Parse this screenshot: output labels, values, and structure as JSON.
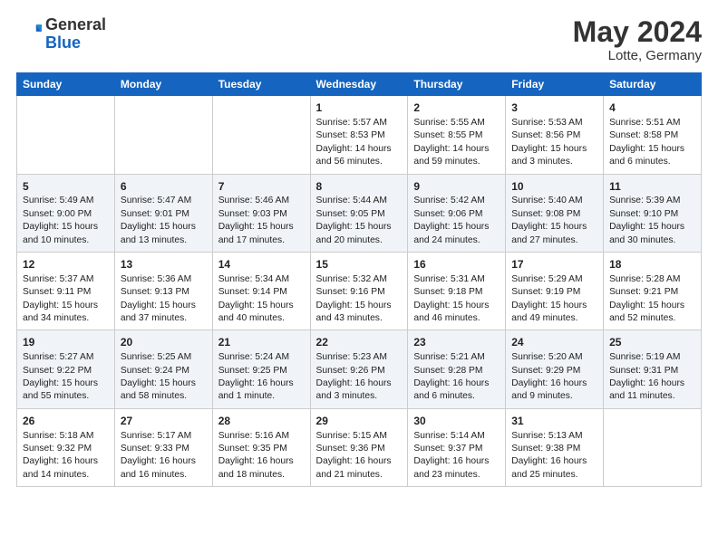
{
  "header": {
    "logo_general": "General",
    "logo_blue": "Blue",
    "month_title": "May 2024",
    "location": "Lotte, Germany"
  },
  "weekdays": [
    "Sunday",
    "Monday",
    "Tuesday",
    "Wednesday",
    "Thursday",
    "Friday",
    "Saturday"
  ],
  "weeks": [
    [
      {
        "day": "",
        "info": ""
      },
      {
        "day": "",
        "info": ""
      },
      {
        "day": "",
        "info": ""
      },
      {
        "day": "1",
        "info": "Sunrise: 5:57 AM\nSunset: 8:53 PM\nDaylight: 14 hours\nand 56 minutes."
      },
      {
        "day": "2",
        "info": "Sunrise: 5:55 AM\nSunset: 8:55 PM\nDaylight: 14 hours\nand 59 minutes."
      },
      {
        "day": "3",
        "info": "Sunrise: 5:53 AM\nSunset: 8:56 PM\nDaylight: 15 hours\nand 3 minutes."
      },
      {
        "day": "4",
        "info": "Sunrise: 5:51 AM\nSunset: 8:58 PM\nDaylight: 15 hours\nand 6 minutes."
      }
    ],
    [
      {
        "day": "5",
        "info": "Sunrise: 5:49 AM\nSunset: 9:00 PM\nDaylight: 15 hours\nand 10 minutes."
      },
      {
        "day": "6",
        "info": "Sunrise: 5:47 AM\nSunset: 9:01 PM\nDaylight: 15 hours\nand 13 minutes."
      },
      {
        "day": "7",
        "info": "Sunrise: 5:46 AM\nSunset: 9:03 PM\nDaylight: 15 hours\nand 17 minutes."
      },
      {
        "day": "8",
        "info": "Sunrise: 5:44 AM\nSunset: 9:05 PM\nDaylight: 15 hours\nand 20 minutes."
      },
      {
        "day": "9",
        "info": "Sunrise: 5:42 AM\nSunset: 9:06 PM\nDaylight: 15 hours\nand 24 minutes."
      },
      {
        "day": "10",
        "info": "Sunrise: 5:40 AM\nSunset: 9:08 PM\nDaylight: 15 hours\nand 27 minutes."
      },
      {
        "day": "11",
        "info": "Sunrise: 5:39 AM\nSunset: 9:10 PM\nDaylight: 15 hours\nand 30 minutes."
      }
    ],
    [
      {
        "day": "12",
        "info": "Sunrise: 5:37 AM\nSunset: 9:11 PM\nDaylight: 15 hours\nand 34 minutes."
      },
      {
        "day": "13",
        "info": "Sunrise: 5:36 AM\nSunset: 9:13 PM\nDaylight: 15 hours\nand 37 minutes."
      },
      {
        "day": "14",
        "info": "Sunrise: 5:34 AM\nSunset: 9:14 PM\nDaylight: 15 hours\nand 40 minutes."
      },
      {
        "day": "15",
        "info": "Sunrise: 5:32 AM\nSunset: 9:16 PM\nDaylight: 15 hours\nand 43 minutes."
      },
      {
        "day": "16",
        "info": "Sunrise: 5:31 AM\nSunset: 9:18 PM\nDaylight: 15 hours\nand 46 minutes."
      },
      {
        "day": "17",
        "info": "Sunrise: 5:29 AM\nSunset: 9:19 PM\nDaylight: 15 hours\nand 49 minutes."
      },
      {
        "day": "18",
        "info": "Sunrise: 5:28 AM\nSunset: 9:21 PM\nDaylight: 15 hours\nand 52 minutes."
      }
    ],
    [
      {
        "day": "19",
        "info": "Sunrise: 5:27 AM\nSunset: 9:22 PM\nDaylight: 15 hours\nand 55 minutes."
      },
      {
        "day": "20",
        "info": "Sunrise: 5:25 AM\nSunset: 9:24 PM\nDaylight: 15 hours\nand 58 minutes."
      },
      {
        "day": "21",
        "info": "Sunrise: 5:24 AM\nSunset: 9:25 PM\nDaylight: 16 hours\nand 1 minute."
      },
      {
        "day": "22",
        "info": "Sunrise: 5:23 AM\nSunset: 9:26 PM\nDaylight: 16 hours\nand 3 minutes."
      },
      {
        "day": "23",
        "info": "Sunrise: 5:21 AM\nSunset: 9:28 PM\nDaylight: 16 hours\nand 6 minutes."
      },
      {
        "day": "24",
        "info": "Sunrise: 5:20 AM\nSunset: 9:29 PM\nDaylight: 16 hours\nand 9 minutes."
      },
      {
        "day": "25",
        "info": "Sunrise: 5:19 AM\nSunset: 9:31 PM\nDaylight: 16 hours\nand 11 minutes."
      }
    ],
    [
      {
        "day": "26",
        "info": "Sunrise: 5:18 AM\nSunset: 9:32 PM\nDaylight: 16 hours\nand 14 minutes."
      },
      {
        "day": "27",
        "info": "Sunrise: 5:17 AM\nSunset: 9:33 PM\nDaylight: 16 hours\nand 16 minutes."
      },
      {
        "day": "28",
        "info": "Sunrise: 5:16 AM\nSunset: 9:35 PM\nDaylight: 16 hours\nand 18 minutes."
      },
      {
        "day": "29",
        "info": "Sunrise: 5:15 AM\nSunset: 9:36 PM\nDaylight: 16 hours\nand 21 minutes."
      },
      {
        "day": "30",
        "info": "Sunrise: 5:14 AM\nSunset: 9:37 PM\nDaylight: 16 hours\nand 23 minutes."
      },
      {
        "day": "31",
        "info": "Sunrise: 5:13 AM\nSunset: 9:38 PM\nDaylight: 16 hours\nand 25 minutes."
      },
      {
        "day": "",
        "info": ""
      }
    ]
  ]
}
